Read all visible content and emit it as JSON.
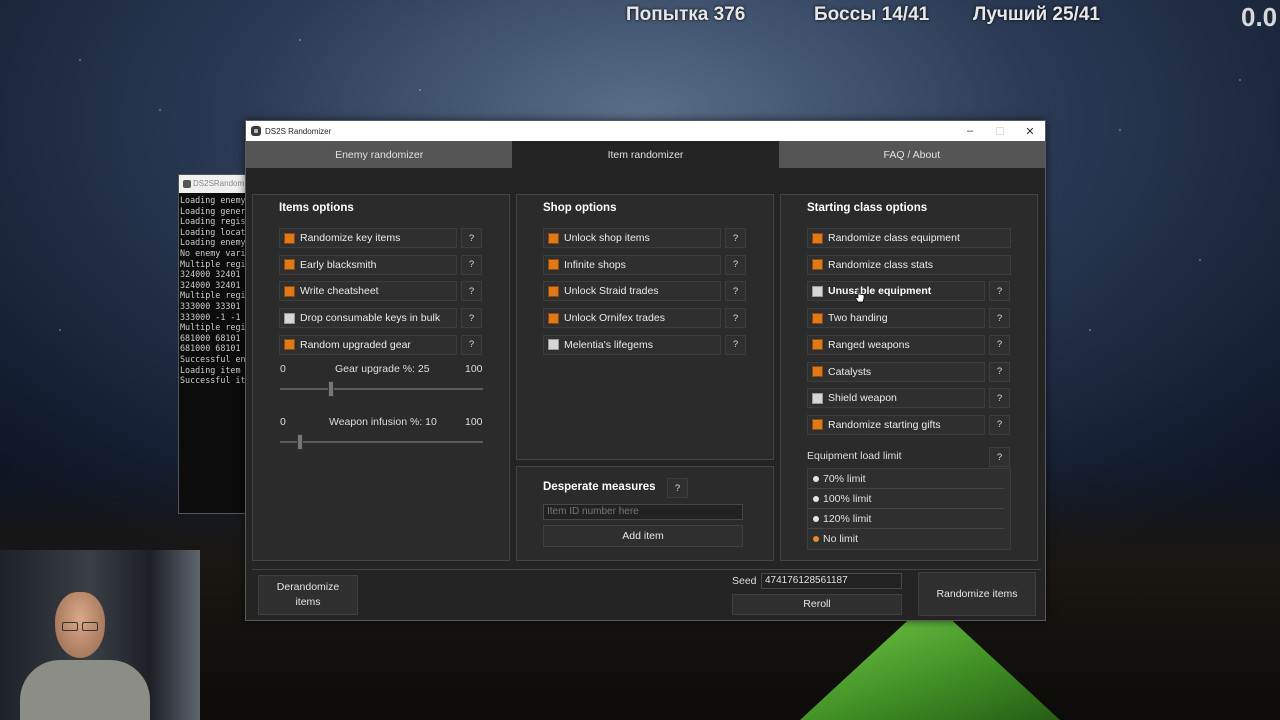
{
  "overlay": {
    "attempt": "Попытка 376",
    "bosses": "Боссы 14/41",
    "best": "Лучший 25/41",
    "timer": "0.0"
  },
  "console": {
    "title": "DS2SRandom",
    "lines": [
      "Loading enemy",
      "Loading gener",
      "Loading regis",
      "Loading locat",
      "Loading enemy",
      "No enemy vari",
      "Multiple regi",
      "324000 32401",
      "324000 32401",
      "Multiple regi",
      "333000 33301",
      "333000 -1 -1",
      "Multiple regi",
      "681000 68101",
      "681000 68101",
      "Successful en",
      "Loading item",
      "Successful it"
    ]
  },
  "window": {
    "title": "DS2S Randomizer",
    "min": "–",
    "max": "☐",
    "close": "✕"
  },
  "tabs": [
    {
      "label": "Enemy randomizer",
      "active": false
    },
    {
      "label": "Item randomizer",
      "active": true
    },
    {
      "label": "FAQ / About",
      "active": false
    }
  ],
  "items_options": {
    "title": "Items options",
    "options": [
      {
        "label": "Randomize key items",
        "checked": true
      },
      {
        "label": "Early blacksmith",
        "checked": true
      },
      {
        "label": "Write cheatsheet",
        "checked": true
      },
      {
        "label": "Drop consumable keys in bulk",
        "checked": false
      },
      {
        "label": "Random upgraded gear",
        "checked": true
      }
    ],
    "gear_upgrade": {
      "label": "Gear upgrade %: 25",
      "min": "0",
      "max": "100",
      "value": 25
    },
    "weapon_infusion": {
      "label": "Weapon infusion %: 10",
      "min": "0",
      "max": "100",
      "value": 10
    }
  },
  "shop_options": {
    "title": "Shop options",
    "options": [
      {
        "label": "Unlock shop items",
        "checked": true
      },
      {
        "label": "Infinite shops",
        "checked": true
      },
      {
        "label": "Unlock Straid trades",
        "checked": true
      },
      {
        "label": "Unlock Ornifex trades",
        "checked": true
      },
      {
        "label": "Melentia's lifegems",
        "checked": false
      }
    ]
  },
  "desperate": {
    "title": "Desperate measures",
    "placeholder": "Item ID number here",
    "add_label": "Add item"
  },
  "class_options": {
    "title": "Starting class options",
    "options": [
      {
        "label": "Randomize class equipment",
        "checked": true
      },
      {
        "label": "Randomize class stats",
        "checked": true
      },
      {
        "label": "Unusable equipment",
        "checked": false
      },
      {
        "label": "Two handing",
        "checked": true
      },
      {
        "label": "Ranged weapons",
        "checked": true
      },
      {
        "label": "Catalysts",
        "checked": true
      },
      {
        "label": "Shield weapon",
        "checked": false
      },
      {
        "label": "Randomize starting gifts",
        "checked": true
      }
    ],
    "load_limit_label": "Equipment load limit",
    "load_limits": [
      {
        "label": "70% limit",
        "selected": false
      },
      {
        "label": "100% limit",
        "selected": false
      },
      {
        "label": "120% limit",
        "selected": false
      },
      {
        "label": "No limit",
        "selected": true
      }
    ]
  },
  "help": "?",
  "bottom": {
    "derandomize": "Derandomize items",
    "seed_label": "Seed",
    "seed_value": "474176128561187",
    "reroll": "Reroll",
    "randomize": "Randomize items"
  },
  "colors": {
    "checked": "#e07a19",
    "unchecked": "#d6d6d6",
    "window_bg": "#242424"
  }
}
